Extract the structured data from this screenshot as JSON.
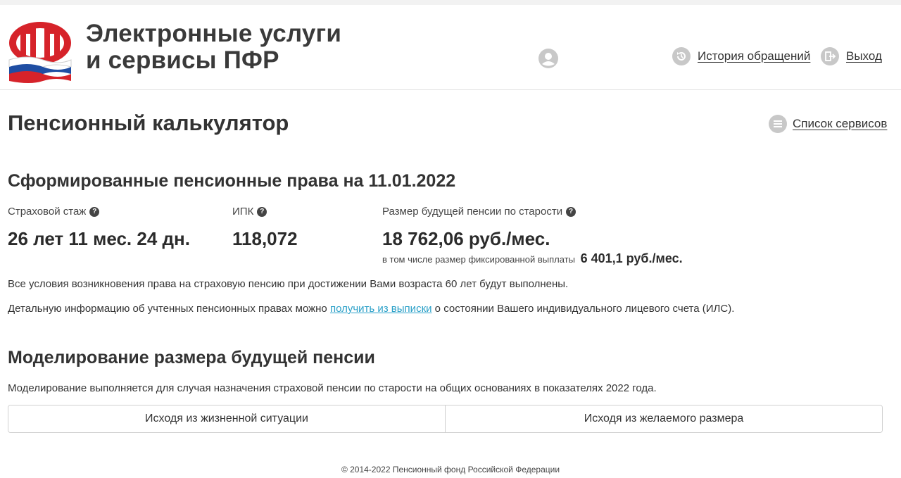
{
  "header": {
    "title_line1": "Электронные услуги",
    "title_line2": "и сервисы ПФР",
    "history_label": "История обращений",
    "exit_label": "Выход"
  },
  "page": {
    "title": "Пенсионный калькулятор",
    "services_label": "Список сервисов"
  },
  "rights": {
    "title": "Сформированные пенсионные права на 11.01.2022",
    "stazh_label": "Страховой стаж",
    "stazh_value": "26 лет 11 мес. 24 дн.",
    "ipk_label": "ИПК",
    "ipk_value": "118,072",
    "pension_label": "Размер будущей пенсии по старости",
    "pension_value": "18 762,06 руб./мес.",
    "fixed_prefix": "в том числе размер фиксированной выплаты",
    "fixed_value": "6 401,1 руб./мес.",
    "conditions_text": "Все условия возникновения права на страховую пенсию при достижении Вами возраста 60 лет будут выполнены.",
    "detail_before": "Детальную информацию об учтенных пенсионных правах можно ",
    "detail_link": "получить из выписки",
    "detail_after": " о состоянии Вашего индивидуального лицевого счета (ИЛС)."
  },
  "modeling": {
    "title": "Моделирование размера будущей пенсии",
    "description": "Моделирование выполняется для случая назначения страховой пенсии по старости на общих основаниях в показателях 2022 года.",
    "tab_situation": "Исходя из жизненной ситуации",
    "tab_desired": "Исходя из желаемого размера"
  },
  "footer": {
    "copyright": "© 2014-2022 Пенсионный фонд Российской Федерации"
  },
  "colors": {
    "logo_red": "#d6232a",
    "flag_blue": "#1f4ea3",
    "link_blue": "#2aa0c8",
    "icon_gray": "#c8c8c8"
  }
}
